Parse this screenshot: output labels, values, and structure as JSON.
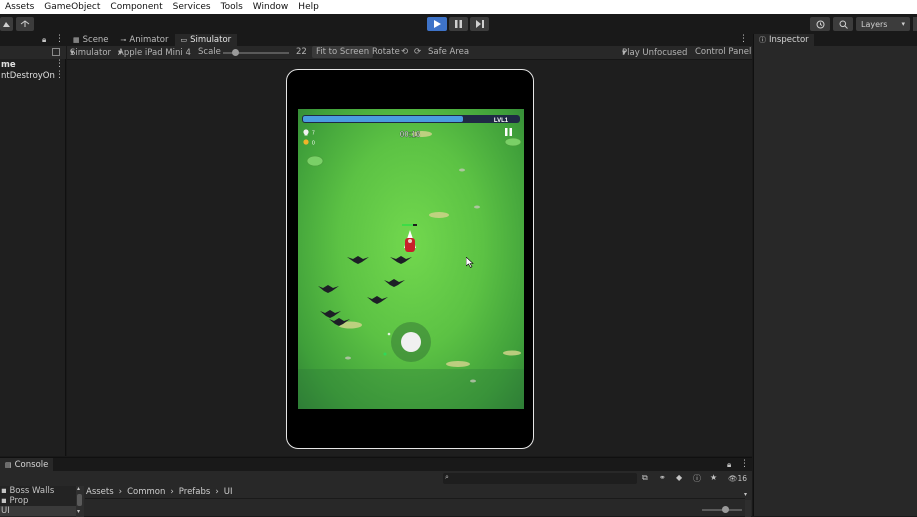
{
  "menu": [
    "Assets",
    "GameObject",
    "Component",
    "Services",
    "Tools",
    "Window",
    "Help"
  ],
  "toolbar": {
    "layers_label": "Layers"
  },
  "hierarchy": {
    "row1": "me",
    "row2": "ntDestroyOnl"
  },
  "tabs": {
    "scene": "Scene",
    "animator": "Animator",
    "simulator": "Simulator"
  },
  "simbar": {
    "mode": "Simulator",
    "device": "Apple iPad Mini 4",
    "scale_label": "Scale",
    "scale_value": "22",
    "scale_level": 0.15,
    "fit_label": "Fit to Screen",
    "rotate_label": "Rotate",
    "safe_label": "Safe Area",
    "play_mode": "Play Unfocused",
    "control_panel": "Control Panel"
  },
  "game": {
    "level_label": "LVL1",
    "xp_progress": 0.9,
    "timer": "00:16",
    "kills": "7",
    "coins": "0"
  },
  "inspector": {
    "tab": "Inspector"
  },
  "console": {
    "tab": "Console"
  },
  "project": {
    "items": [
      "Boss Walls",
      "Prop",
      "UI"
    ],
    "breadcrumb": [
      "Assets",
      "Common",
      "Prefabs",
      "UI"
    ],
    "count": "16"
  },
  "colors": {
    "play_active": "#3e73c8",
    "grass": "#5cc244",
    "xp_bar": "#4a9de0"
  }
}
